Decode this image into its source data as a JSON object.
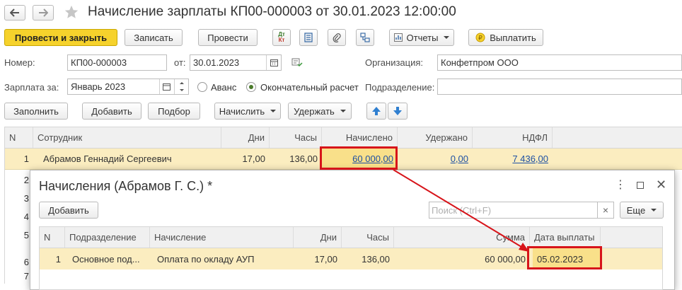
{
  "window": {
    "title": "Начисление зарплаты КП00-000003 от 30.01.2023 12:00:00"
  },
  "toolbar": {
    "post_close_label": "Провести и закрыть",
    "save_label": "Записать",
    "post_label": "Провести",
    "dt_kt_label_top": "Дт",
    "dt_kt_label_bottom": "Кт",
    "reports_label": "Отчеты",
    "pay_label": "Выплатить"
  },
  "form": {
    "number_label": "Номер:",
    "number_value": "КП00-000003",
    "date_label": "от:",
    "date_value": "30.01.2023",
    "org_label": "Организация:",
    "org_value": "Конфетпром ООО",
    "salary_for_label": "Зарплата за:",
    "salary_for_value": "Январь 2023",
    "radio_advance": "Аванс",
    "radio_final": "Окончательный расчет",
    "department_label": "Подразделение:",
    "department_value": ""
  },
  "actions": {
    "fill": "Заполнить",
    "add": "Добавить",
    "select": "Подбор",
    "accrue": "Начислить",
    "withhold": "Удержать"
  },
  "table": {
    "headers": [
      "N",
      "Сотрудник",
      "Дни",
      "Часы",
      "Начислено",
      "Удержано",
      "НДФЛ"
    ],
    "row": {
      "n": "1",
      "employee": "Абрамов Геннадий Сергеевич",
      "days": "17,00",
      "hours": "136,00",
      "accrued": "60 000,00",
      "withheld": "0,00",
      "ndfl": "7 436,00"
    },
    "partial_row_numbers": [
      "2",
      "3",
      "4",
      "5",
      "6",
      "7"
    ]
  },
  "dialog": {
    "title": "Начисления (Абрамов Г. С.) *",
    "add_label": "Добавить",
    "search_placeholder": "Поиск (Ctrl+F)",
    "clear_symbol": "×",
    "more_label": "Еще",
    "headers": [
      "N",
      "Подразделение",
      "Начисление",
      "Дни",
      "Часы",
      "Сумма",
      "Дата выплаты"
    ],
    "row": {
      "n": "1",
      "department": "Основное под...",
      "accrual": "Оплата по окладу АУП",
      "days": "17,00",
      "hours": "136,00",
      "sum": "60 000,00",
      "pay_date": "05.02.2023"
    }
  },
  "colors": {
    "accent_yellow": "#f6d22c",
    "selected_row": "#fbedc0",
    "highlight_red": "#d7141a",
    "link_blue": "#1c4fa3"
  }
}
